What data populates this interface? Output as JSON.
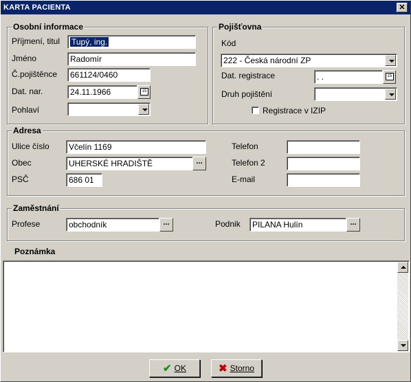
{
  "window": {
    "title": "KARTA PACIENTA",
    "close_glyph": "✕"
  },
  "personal": {
    "legend": "Osobní informace",
    "prijmeni_label": "Příjmení, titul",
    "prijmeni_value": "Tupý, ing.",
    "jmeno_label": "Jméno",
    "jmeno_value": "Radomír",
    "cpoj_label": "Č.pojištěnce",
    "cpoj_value": "661124/0460",
    "datnar_label": "Dat. nar.",
    "datnar_value": "24.11.1966",
    "pohlavi_label": "Pohlaví",
    "pohlavi_value": ""
  },
  "insurance": {
    "legend": "Pojišťovna",
    "kod_label": "Kód",
    "kod_value": "222 - Česká národní ZP",
    "datreg_label": "Dat. registrace",
    "datreg_value": " . .",
    "druh_label": "Druh pojištění",
    "druh_value": "",
    "izip_label": "Registrace v IZIP",
    "izip_checked": false
  },
  "address": {
    "legend": "Adresa",
    "ulice_label": "Ulice číslo",
    "ulice_value": "Včelín 1169",
    "obec_label": "Obec",
    "obec_value": "UHERSKÉ HRADIŠTĚ",
    "psc_label": "PSČ",
    "psc_value": "686 01",
    "telefon_label": "Telefon",
    "telefon_value": "",
    "telefon2_label": "Telefon 2",
    "telefon2_value": "",
    "email_label": "E-mail",
    "email_value": ""
  },
  "employment": {
    "legend": "Zaměstnání",
    "profese_label": "Profese",
    "profese_value": "obchodník",
    "podnik_label": "Podnik",
    "podnik_value": "PILANA Hulín"
  },
  "note": {
    "label": "Poznámka",
    "value": ""
  },
  "buttons": {
    "ok_label": "OK",
    "storno_label": "Storno",
    "browse_label": "...",
    "calendar_glyph": "15"
  },
  "colors": {
    "titlebar": "#0a246a",
    "face": "#d4d0c8",
    "ok_icon": "#1a8f1a",
    "cancel_icon": "#c00000"
  }
}
